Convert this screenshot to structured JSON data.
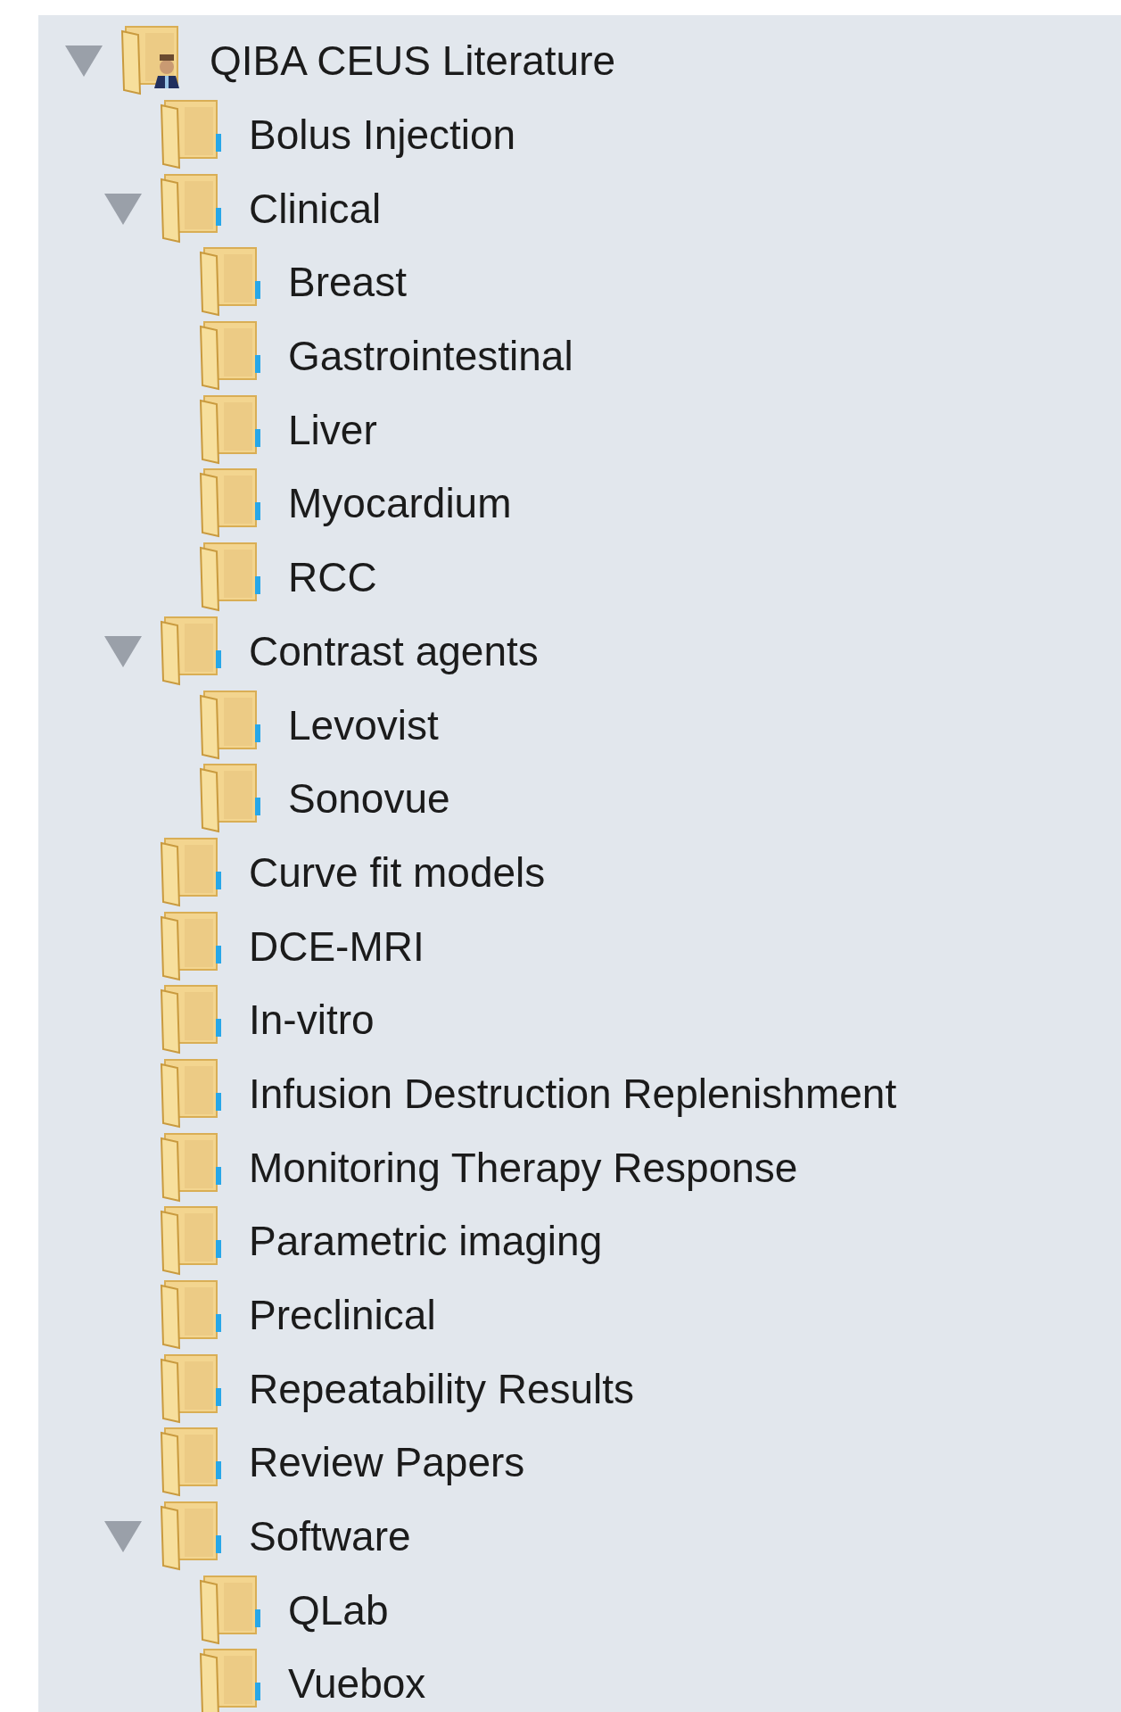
{
  "tree": {
    "label": "QIBA CEUS Literature",
    "kind": "shared",
    "expanded": true,
    "children": [
      {
        "label": "Bolus Injection",
        "kind": "folder"
      },
      {
        "label": "Clinical",
        "kind": "folder",
        "expanded": true,
        "children": [
          {
            "label": "Breast",
            "kind": "folder"
          },
          {
            "label": "Gastrointestinal",
            "kind": "folder"
          },
          {
            "label": "Liver",
            "kind": "folder"
          },
          {
            "label": "Myocardium",
            "kind": "folder"
          },
          {
            "label": "RCC",
            "kind": "folder"
          }
        ]
      },
      {
        "label": "Contrast agents",
        "kind": "folder",
        "expanded": true,
        "children": [
          {
            "label": "Levovist",
            "kind": "folder"
          },
          {
            "label": "Sonovue",
            "kind": "folder"
          }
        ]
      },
      {
        "label": "Curve fit models",
        "kind": "folder"
      },
      {
        "label": "DCE-MRI",
        "kind": "folder"
      },
      {
        "label": "In-vitro",
        "kind": "folder"
      },
      {
        "label": "Infusion Destruction Replenishment",
        "kind": "folder"
      },
      {
        "label": "Monitoring Therapy Response",
        "kind": "folder"
      },
      {
        "label": "Parametric imaging",
        "kind": "folder"
      },
      {
        "label": "Preclinical",
        "kind": "folder"
      },
      {
        "label": "Repeatability Results",
        "kind": "folder"
      },
      {
        "label": "Review Papers",
        "kind": "folder"
      },
      {
        "label": "Software",
        "kind": "folder",
        "expanded": true,
        "children": [
          {
            "label": "QLab",
            "kind": "folder"
          },
          {
            "label": "Vuebox",
            "kind": "folder"
          }
        ]
      }
    ]
  }
}
